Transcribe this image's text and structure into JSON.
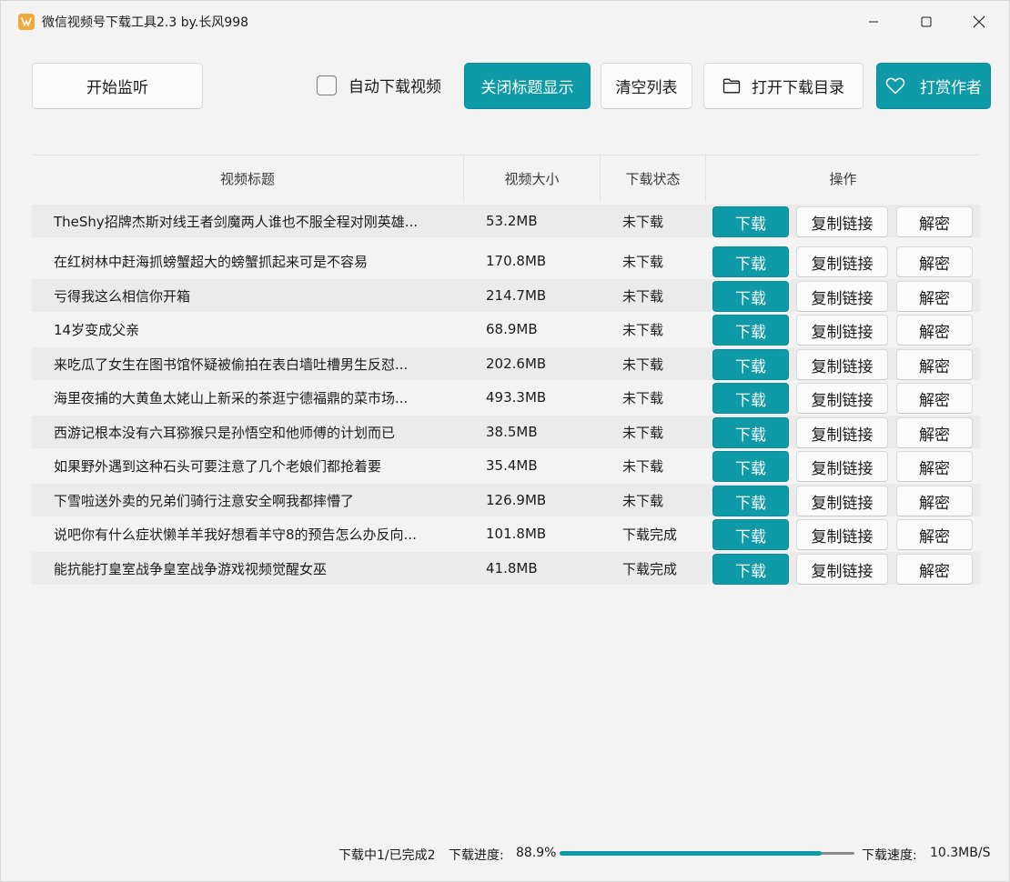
{
  "window": {
    "title": "微信视频号下载工具2.3 by.长风998"
  },
  "toolbar": {
    "start_label": "开始监听",
    "auto_download_label": "自动下载视频",
    "auto_download_checked": false,
    "hide_title_label": "关闭标题显示",
    "clear_label": "清空列表",
    "open_dir_label": "打开下载目录",
    "donate_label": "打赏作者"
  },
  "table": {
    "headers": {
      "title": "视频标题",
      "size": "视频大小",
      "status": "下载状态",
      "ops": "操作"
    },
    "rows": [
      {
        "title": "TheShy招牌杰斯对线王者剑魔两人谁也不服全程对刚英雄...",
        "size": "53.2MB",
        "status": "未下载",
        "download": "下载",
        "copy": "复制链接",
        "decrypt": "解密"
      },
      {
        "title": "在红树林中赶海抓螃蟹超大的螃蟹抓起来可是不容易",
        "size": "170.8MB",
        "status": "未下载",
        "download": "下载",
        "copy": "复制链接",
        "decrypt": "解密"
      },
      {
        "title": "亏得我这么相信你开箱",
        "size": "214.7MB",
        "status": "未下载",
        "download": "下载",
        "copy": "复制链接",
        "decrypt": "解密"
      },
      {
        "title": "14岁变成父亲",
        "size": "68.9MB",
        "status": "未下载",
        "download": "下载",
        "copy": "复制链接",
        "decrypt": "解密"
      },
      {
        "title": "来吃瓜了女生在图书馆怀疑被偷拍在表白墙吐槽男生反怼...",
        "size": "202.6MB",
        "status": "未下载",
        "download": "下载",
        "copy": "复制链接",
        "decrypt": "解密"
      },
      {
        "title": "海里夜捕的大黄鱼太姥山上新采的茶逛宁德福鼎的菜市场...",
        "size": "493.3MB",
        "status": "未下载",
        "download": "下载",
        "copy": "复制链接",
        "decrypt": "解密"
      },
      {
        "title": "西游记根本没有六耳猕猴只是孙悟空和他师傅的计划而已",
        "size": "38.5MB",
        "status": "未下载",
        "download": "下载",
        "copy": "复制链接",
        "decrypt": "解密"
      },
      {
        "title": "如果野外遇到这种石头可要注意了几个老娘们都抢着要",
        "size": "35.4MB",
        "status": "未下载",
        "download": "下载",
        "copy": "复制链接",
        "decrypt": "解密"
      },
      {
        "title": "下雪啦送外卖的兄弟们骑行注意安全啊我都摔懵了",
        "size": "126.9MB",
        "status": "未下载",
        "download": "下载",
        "copy": "复制链接",
        "decrypt": "解密"
      },
      {
        "title": "说吧你有什么症状懒羊羊我好想看羊守8的预告怎么办反向...",
        "size": "101.8MB",
        "status": "下载完成",
        "download": "下载",
        "copy": "复制链接",
        "decrypt": "解密"
      },
      {
        "title": "能抗能打皇室战争皇室战争游戏视频觉醒女巫",
        "size": "41.8MB",
        "status": "下载完成",
        "download": "下载",
        "copy": "复制链接",
        "decrypt": "解密"
      }
    ]
  },
  "statusbar": {
    "count_text": "下载中1/已完成2",
    "progress_label": "下载进度:",
    "progress_text": "88.9%",
    "progress_value": 0.889,
    "speed_label": "下载速度:",
    "speed_text": "10.3MB/S"
  },
  "colors": {
    "accent": "#0e9aa7",
    "window_bg": "#f3f3f3",
    "row_alt": "#ebebeb"
  },
  "icons": {
    "app": "app-logo-icon",
    "minimize": "minimize-icon",
    "maximize": "maximize-icon",
    "close": "close-icon",
    "folder": "folder-icon",
    "heart": "heart-icon"
  }
}
